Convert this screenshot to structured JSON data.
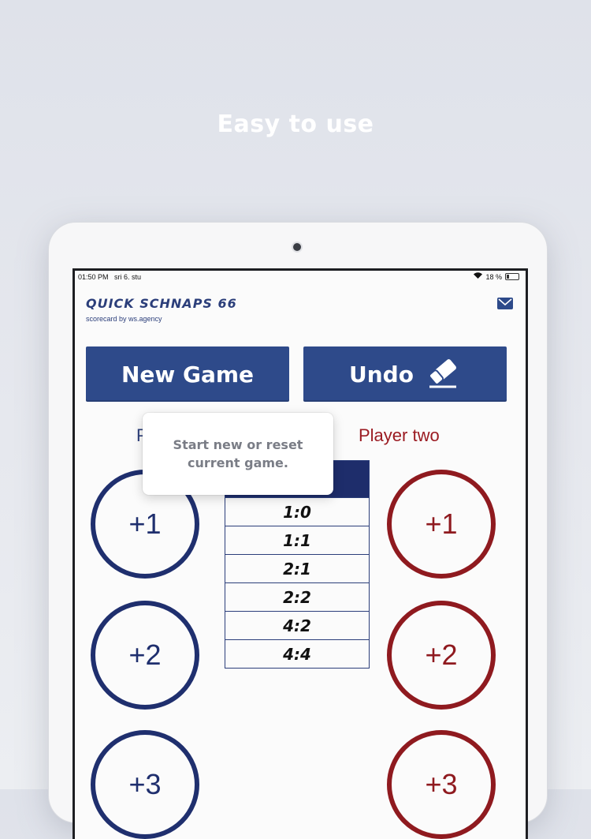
{
  "headline": "Easy to use",
  "statusbar": {
    "time": "01:50 PM",
    "date": "sri 6. stu",
    "battery": "18 %"
  },
  "app": {
    "title": "QUICK SCHNAPS 66",
    "subtitle": "scorecard by ws.agency"
  },
  "buttons": {
    "new_game": "New Game",
    "undo": "Undo"
  },
  "players": {
    "one": "P",
    "two": "Player two"
  },
  "tooltip": {
    "text": "Start new or reset\ncurrent game."
  },
  "scores": [
    "1:0",
    "1:1",
    "2:1",
    "2:2",
    "4:2",
    "4:4"
  ],
  "points": {
    "one": "+1",
    "two": "+2",
    "three": "+3"
  },
  "colors": {
    "blue": "#2e4a8a",
    "navy": "#1f2f6e",
    "red": "#8f1a1f"
  },
  "icons": {
    "mail": "mail-icon",
    "undo": "eraser-icon",
    "wifi": "wifi-icon",
    "battery": "battery-icon"
  }
}
